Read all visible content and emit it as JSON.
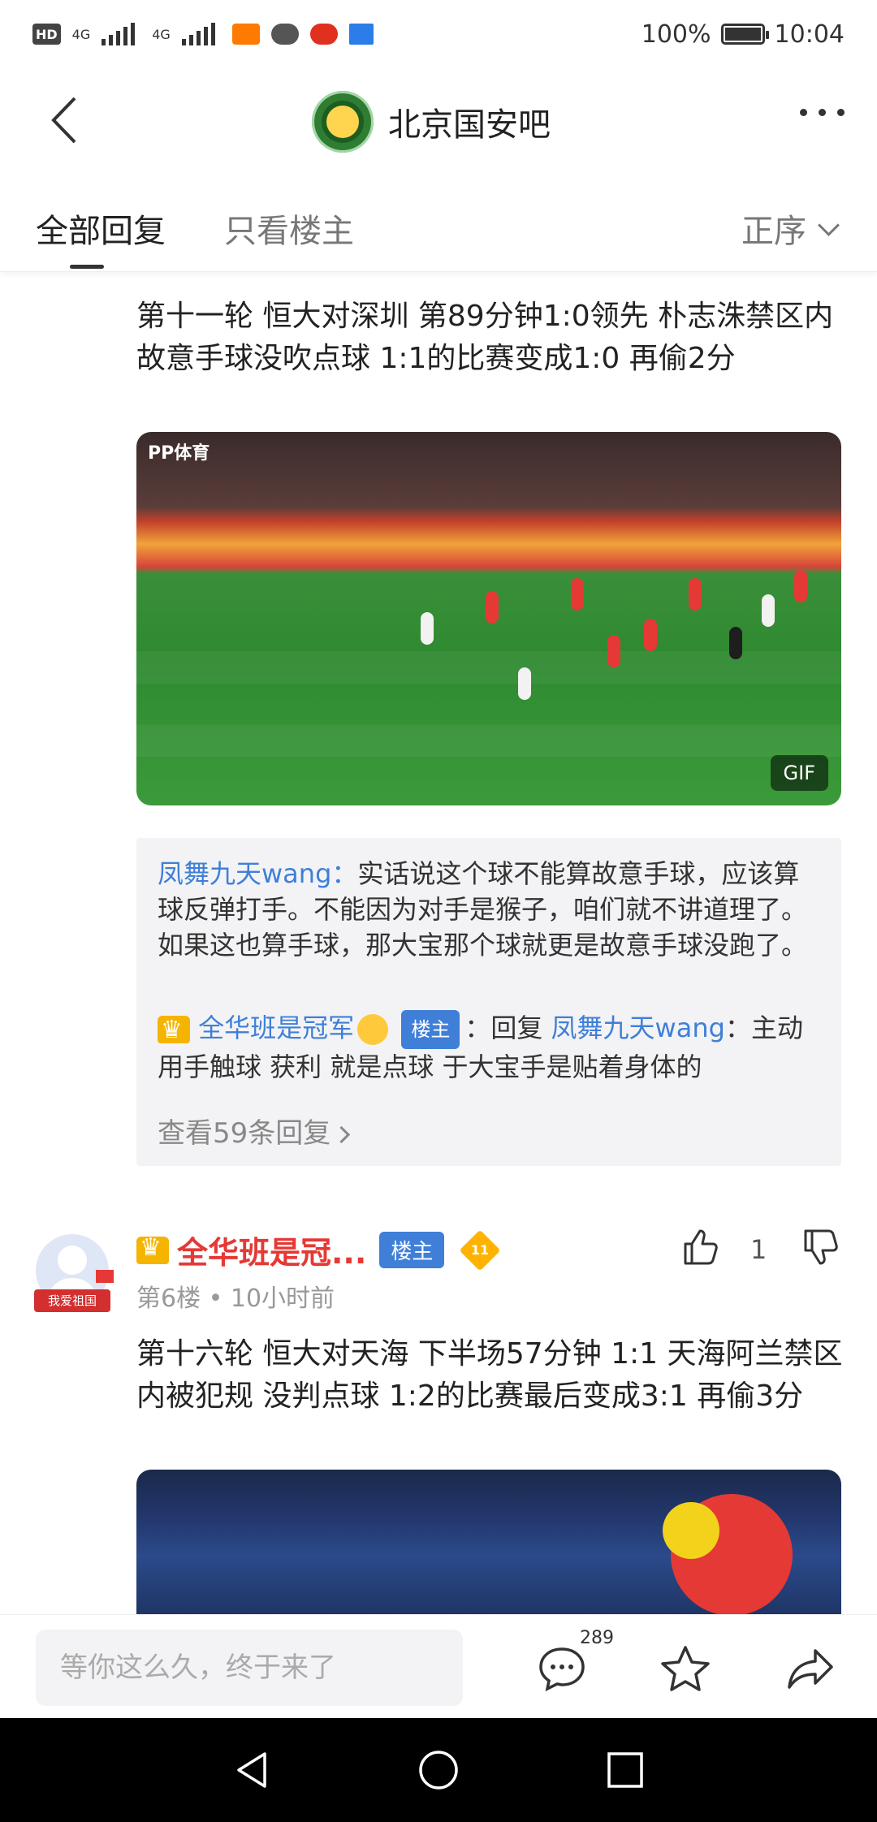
{
  "status_bar": {
    "left_icons": [
      "hd-icon",
      "signal-4g-1",
      "signal-4g-2",
      "app-notification-icon",
      "wechat-icon",
      "sina-icon",
      "youku-icon"
    ],
    "hd_label": "HD",
    "sim1": "4G",
    "sim2": "4G",
    "battery_pct": "100%",
    "time": "10:04"
  },
  "header": {
    "forum_name": "北京国安吧"
  },
  "tabs": {
    "all_replies": "全部回复",
    "only_op": "只看楼主",
    "sort_label": "正序"
  },
  "post5": {
    "text": "第十一轮 恒大对深圳 第89分钟1:0领先 朴志洙禁区内故意手球没吹点球 1:1的比赛变成1:0 再偷2分",
    "media_badge": "GIF",
    "broadcast_logo": "PP体育",
    "replies": {
      "r1_user": "凤舞九天wang",
      "r1_colon": "：",
      "r1_text": "实话说这个球不能算故意手球，应该算球反弹打手。不能因为对手是猴子，咱们就不讲道理了。如果这也算手球，那大宝那个球就更是故意手球没跑了。",
      "r2_user": "全华班是冠军",
      "r2_badge": "楼主",
      "r2_reply_word": "：回复",
      "r2_target": "凤舞九天wang",
      "r2_text": "：主动用手触球 获利 就是点球 于大宝手是贴着身体的",
      "view_more": "查看59条回复"
    }
  },
  "post6": {
    "avatar_banner": "我爱祖国",
    "author": "全华班是冠...",
    "op_badge": "楼主",
    "level": "11",
    "floor_meta": "第6楼 • 10小时前",
    "like_count": "1",
    "text": "第十六轮 恒大对天海 下半场57分钟 1:1 天海阿兰禁区内被犯规 没判点球 1:2的比赛最后变成3:1 再偷3分"
  },
  "bottom_bar": {
    "input_placeholder": "等你这么久，终于来了",
    "comment_count": "289"
  },
  "colors": {
    "accent_blue": "#3f7fd8",
    "author_red": "#e53935",
    "badge_bg": "#3f7fd8"
  }
}
